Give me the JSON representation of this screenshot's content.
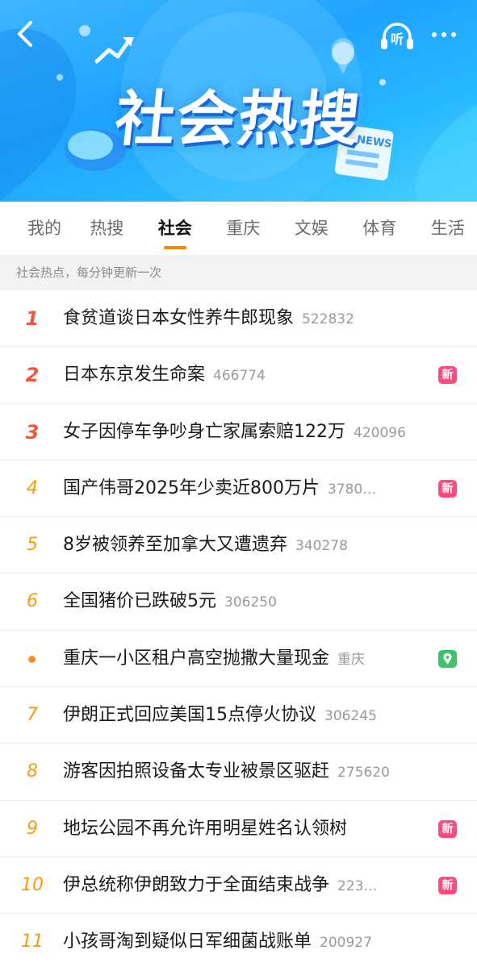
{
  "banner": {
    "title": "社会热搜",
    "listen_label": "听",
    "news_label": "NEWS",
    "colors": {
      "bg": "#1fa3ff",
      "title_shadow": "#1767d6"
    }
  },
  "tabs": [
    {
      "label": "我的",
      "active": false
    },
    {
      "label": "热搜",
      "active": false
    },
    {
      "label": "社会",
      "active": true
    },
    {
      "label": "重庆",
      "active": false
    },
    {
      "label": "文娱",
      "active": false
    },
    {
      "label": "体育",
      "active": false
    },
    {
      "label": "生活",
      "active": false
    }
  ],
  "notice": "社会热点，每分钟更新一次",
  "items": [
    {
      "rank": "1",
      "title": "食贫道谈日本女性养牛郎现象",
      "count": "522832",
      "badge": null
    },
    {
      "rank": "2",
      "title": "日本东京发生命案",
      "count": "466774",
      "badge": "新"
    },
    {
      "rank": "3",
      "title": "女子因停车争吵身亡家属索赔122万",
      "count": "420096",
      "badge": null
    },
    {
      "rank": "4",
      "title": "国产伟哥2025年少卖近800万片",
      "count": "3780…",
      "badge": "新"
    },
    {
      "rank": "5",
      "title": "8岁被领养至加拿大又遭遗弃",
      "count": "340278",
      "badge": null
    },
    {
      "rank": "6",
      "title": "全国猪价已跌破5元",
      "count": "306250",
      "badge": null
    },
    {
      "rank": "",
      "title": "重庆一小区租户高空抛撒大量现金",
      "count": "重庆",
      "badge": "location"
    },
    {
      "rank": "7",
      "title": "伊朗正式回应美国15点停火协议",
      "count": "306245",
      "badge": null
    },
    {
      "rank": "8",
      "title": "游客因拍照设备太专业被景区驱赶",
      "count": "275620",
      "badge": null
    },
    {
      "rank": "9",
      "title": "地坛公园不再允许用明星姓名认领树",
      "count": "",
      "badge": "新"
    },
    {
      "rank": "10",
      "title": "伊总统称伊朗致力于全面结束战争",
      "count": "223…",
      "badge": "新"
    },
    {
      "rank": "11",
      "title": "小孩哥淘到疑似日军细菌战账单",
      "count": "200927",
      "badge": null
    }
  ],
  "icons": {
    "back": "chevron-left-icon",
    "listen": "headphones-icon",
    "more": "more-dots-icon",
    "new_badge": "new-badge-icon",
    "location_badge": "location-pin-icon"
  }
}
